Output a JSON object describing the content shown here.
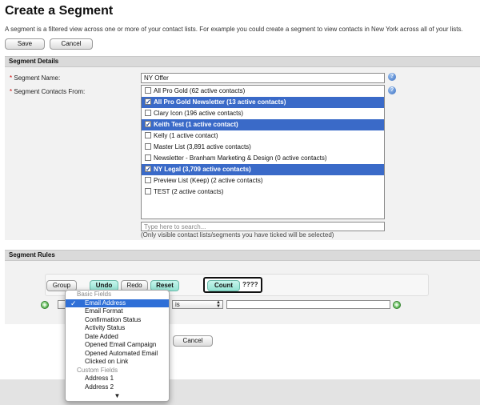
{
  "page": {
    "title": "Create a Segment",
    "description": "A segment is a filtered view across one or more of your contact lists. For example you could create a segment to view contacts in New York across all of your lists."
  },
  "top_buttons": {
    "save": "Save",
    "cancel": "Cancel"
  },
  "segment_details": {
    "heading": "Segment Details",
    "name_label": "Segment Name:",
    "name_value": "NY Offer",
    "contacts_label": "Segment Contacts From:",
    "required_mark": "*",
    "help_icon": "?",
    "lists": [
      {
        "label": "All Pro Gold (62 active contacts)",
        "checked": false
      },
      {
        "label": "All Pro Gold Newsletter (13 active contacts)",
        "checked": true
      },
      {
        "label": "Clary Icon (196 active contacts)",
        "checked": false
      },
      {
        "label": "Keith Test (1 active contact)",
        "checked": true
      },
      {
        "label": "Kelly (1 active contact)",
        "checked": false
      },
      {
        "label": "Master List (3,891 active contacts)",
        "checked": false
      },
      {
        "label": "Newsletter - Branham Marketing & Design (0 active contacts)",
        "checked": false
      },
      {
        "label": "NY Legal (3,709 active contacts)",
        "checked": true
      },
      {
        "label": "Preview List (Keep) (2 active contacts)",
        "checked": false
      },
      {
        "label": "TEST (2 active contacts)",
        "checked": false
      }
    ],
    "search_placeholder": "Type here to search...",
    "hint": "(Only visible contact lists/segments you have ticked will be selected)"
  },
  "segment_rules": {
    "heading": "Segment Rules",
    "group": "Group",
    "undo": "Undo",
    "redo": "Redo",
    "reset": "Reset",
    "count": "Count",
    "count_result": "????",
    "operator": "is",
    "add_icon": "+",
    "field_dropdown": {
      "groups": [
        {
          "name": "Basic Fields",
          "items": [
            "Email Address",
            "Email Format",
            "Confirmation Status",
            "Activity Status",
            "Date Added",
            "Opened Email Campaign",
            "Opened Automated Email",
            "Clicked on Link"
          ]
        },
        {
          "name": "Custom Fields",
          "items": [
            "Address 1",
            "Address 2"
          ]
        }
      ],
      "selected": "Email Address",
      "check_mark": "✓",
      "more_arrow": "▼"
    }
  },
  "bottom_buttons": {
    "cancel": "Cancel"
  },
  "colors": {
    "selected_row": "#3a6ac8",
    "teal_button": "#93e3d3",
    "dropdown_highlight": "#2f6fd7"
  }
}
